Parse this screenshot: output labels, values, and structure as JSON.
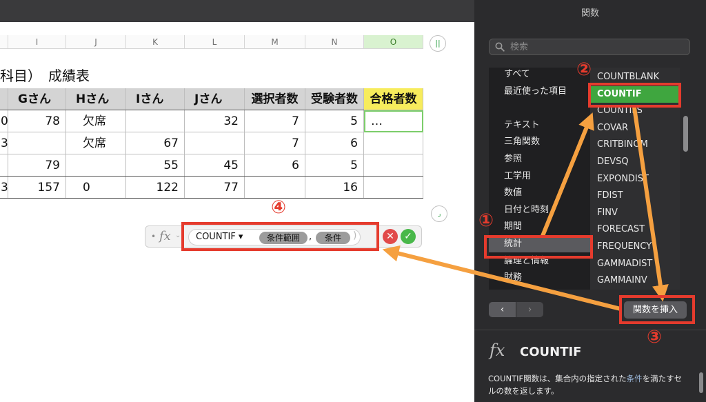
{
  "spreadsheet": {
    "columns": [
      "I",
      "J",
      "K",
      "L",
      "M",
      "N",
      "O"
    ],
    "selected_column": "O",
    "column_menu_icon": "||",
    "table_title": "科目）　成績表",
    "header_row": [
      "Gさん",
      "Hさん",
      "Iさん",
      "Jさん",
      "選択者数",
      "受験者数",
      "合格者数"
    ],
    "rows": [
      [
        "0",
        "78",
        "欠席",
        "",
        "32",
        "7",
        "5",
        "…"
      ],
      [
        "3",
        "",
        "欠席",
        "67",
        "",
        "7",
        "6",
        ""
      ],
      [
        "",
        "79",
        "",
        "55",
        "45",
        "6",
        "5",
        ""
      ],
      [
        "3",
        "157",
        "0",
        "122",
        "77",
        "",
        "16",
        ""
      ]
    ],
    "resize_icon": "⌟"
  },
  "formula_bar": {
    "dot": "•",
    "fx_label": "fx",
    "chevron": "⌄",
    "function_name": "COUNTIF ▾",
    "arg1": "条件範囲",
    "comma": ",",
    "arg2": "条件",
    "paren": ")",
    "cancel": "✕",
    "confirm": "✓"
  },
  "sidebar": {
    "title": "関数",
    "search_placeholder": "検索",
    "categories": [
      "すべて",
      "最近使った項目",
      "",
      "テキスト",
      "三角関数",
      "参照",
      "工学用",
      "数値",
      "日付と時刻",
      "期間",
      "統計",
      "論理と情報",
      "財務"
    ],
    "selected_category": "統計",
    "functions": [
      "COUNTBLANK",
      "COUNTIF",
      "COUNTIFS",
      "COVAR",
      "CRITBINOM",
      "DEVSQ",
      "EXPONDIST",
      "FDIST",
      "FINV",
      "FORECAST",
      "FREQUENCY",
      "GAMMADIST",
      "GAMMAINV"
    ],
    "selected_function": "COUNTIF",
    "back": "‹",
    "forward": "›",
    "insert_label": "関数を挿入",
    "info": {
      "fx": "fx",
      "name": "COUNTIF",
      "desc_a": "COUNTIF関数は、集合内の指定された",
      "desc_hl": "条件",
      "desc_b": "を満たすセルの数を返します。"
    }
  },
  "annotations": {
    "step1": "①",
    "step2": "②",
    "step3": "③",
    "step4": "④"
  },
  "colors": {
    "accent_green": "#3fa63f",
    "annotation_red": "#e53b2d",
    "arrow_orange": "#f5a040",
    "header_yellow": "#f7ec5c"
  }
}
